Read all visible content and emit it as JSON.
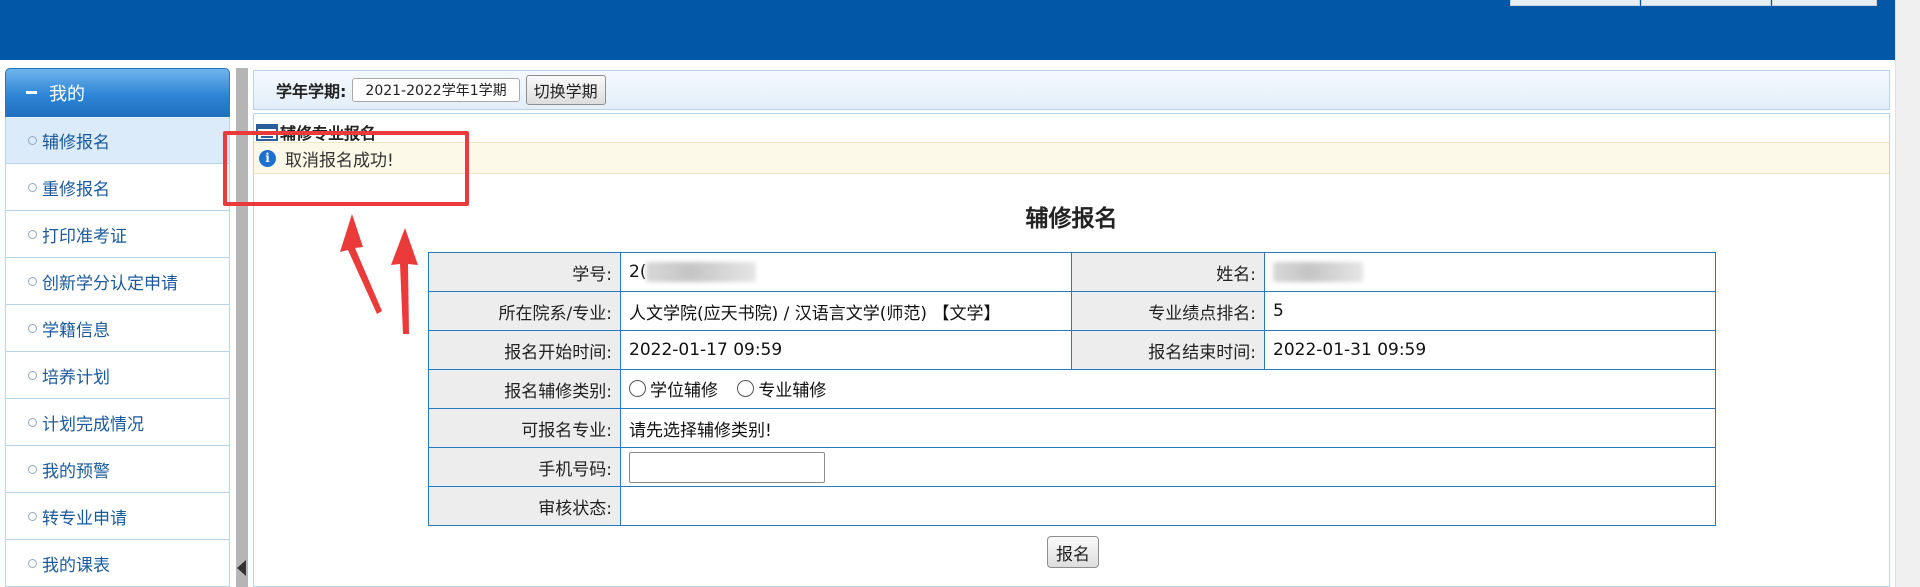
{
  "header": {
    "background": "#0357a7"
  },
  "sidebar": {
    "title": "我的",
    "items": [
      {
        "label": "辅修报名",
        "active": true
      },
      {
        "label": "重修报名"
      },
      {
        "label": "打印准考证"
      },
      {
        "label": "创新学分认定申请"
      },
      {
        "label": "学籍信息"
      },
      {
        "label": "培养计划"
      },
      {
        "label": "计划完成情况"
      },
      {
        "label": "我的预警"
      },
      {
        "label": "转专业申请"
      },
      {
        "label": "我的课表"
      }
    ]
  },
  "toolbar": {
    "term_label": "学年学期:",
    "term_value": "2021-2022学年1学期",
    "switch_label": "切换学期"
  },
  "panel": {
    "title": "辅修专业报名",
    "notice": "取消报名成功!",
    "notice_icon": "info-icon"
  },
  "form": {
    "title": "辅修报名",
    "student_id_label": "学号:",
    "student_id_visible": "2(",
    "name_label": "姓名:",
    "college_label": "所在院系/专业:",
    "college_value": "人文学院(应天书院) / 汉语言文学(师范) 【文学】",
    "gpa_rank_label": "专业绩点排名:",
    "gpa_rank_value": "5",
    "start_time_label": "报名开始时间:",
    "start_time_value": "2022-01-17 09:59",
    "end_time_label": "报名结束时间:",
    "end_time_value": "2022-01-31 09:59",
    "category_label": "报名辅修类别:",
    "category_options": [
      "学位辅修",
      "专业辅修"
    ],
    "major_label": "可报名专业:",
    "major_hint": "请先选择辅修类别!",
    "phone_label": "手机号码:",
    "phone_value": "",
    "status_label": "审核状态:",
    "status_value": "",
    "submit_label": "报名"
  },
  "colors": {
    "accent": "#0357a7",
    "border": "#2a79bf",
    "warning_text": "#e3171b",
    "annotation": "#ea3a3a"
  }
}
